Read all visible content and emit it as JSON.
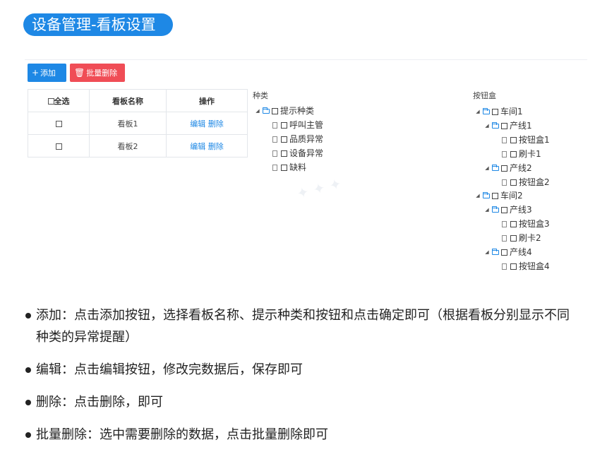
{
  "header": {
    "title": "设备管理-看板设置"
  },
  "toolbar": {
    "add_label": "添加",
    "batch_delete_label": "批量删除",
    "add_icon": "plus-icon",
    "batch_delete_icon": "trash-icon"
  },
  "table": {
    "headers": [
      "全选",
      "看板名称",
      "操作"
    ],
    "rows": [
      {
        "name": "看板1",
        "edit": "编辑",
        "delete": "删除"
      },
      {
        "name": "看板2",
        "edit": "编辑",
        "delete": "删除"
      }
    ]
  },
  "category_tree": {
    "title": "种类",
    "root": "提示种类",
    "items": [
      "呼叫主管",
      "品质异常",
      "设备异常",
      "缺料"
    ]
  },
  "button_tree": {
    "title": "按钮盒",
    "nodes": [
      "车间1",
      "产线1",
      "按钮盒1",
      "刷卡1",
      "产线2",
      "按钮盒2",
      "车间2",
      "产线3",
      "按钮盒3",
      "刷卡2",
      "产线4",
      "按钮盒4"
    ]
  },
  "bullets": [
    "添加：点击添加按钮，选择看板名称、提示种类和按钮和点击确定即可（根据看板分别显示不同种类的异常提醒）",
    "编辑：点击编辑按钮，修改完数据后，保存即可",
    "删除：点击删除，即可",
    "批量删除：选中需要删除的数据，点击批量删除即可"
  ],
  "colors": {
    "accent": "#1e88e5",
    "danger": "#f04d56",
    "text": "#222222"
  }
}
